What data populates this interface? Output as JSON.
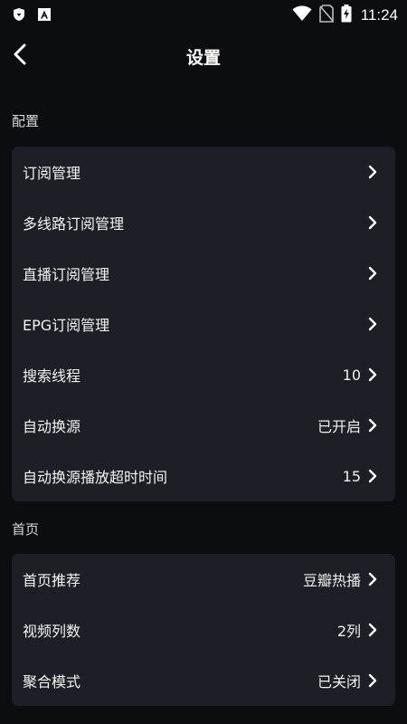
{
  "status_bar": {
    "time": "11:24",
    "left_icons": [
      "shield-icon",
      "a-icon"
    ],
    "right_icons": [
      "wifi-icon",
      "no-sim-icon",
      "battery-charging-icon"
    ]
  },
  "header": {
    "title": "设置",
    "back_icon": "chevron-left-icon"
  },
  "sections": [
    {
      "label": "配置",
      "items": [
        {
          "label": "订阅管理",
          "value": ""
        },
        {
          "label": "多线路订阅管理",
          "value": ""
        },
        {
          "label": "直播订阅管理",
          "value": ""
        },
        {
          "label": "EPG订阅管理",
          "value": ""
        },
        {
          "label": "搜索线程",
          "value": "10"
        },
        {
          "label": "自动换源",
          "value": "已开启"
        },
        {
          "label": "自动换源播放超时时间",
          "value": "15"
        }
      ]
    },
    {
      "label": "首页",
      "items": [
        {
          "label": "首页推荐",
          "value": "豆瓣热播"
        },
        {
          "label": "视频列数",
          "value": "2列"
        },
        {
          "label": "聚合模式",
          "value": "已关闭"
        }
      ]
    }
  ],
  "colors": {
    "background": "#0c0d11",
    "card": "#1d1f27",
    "text": "#f4f4f4"
  }
}
